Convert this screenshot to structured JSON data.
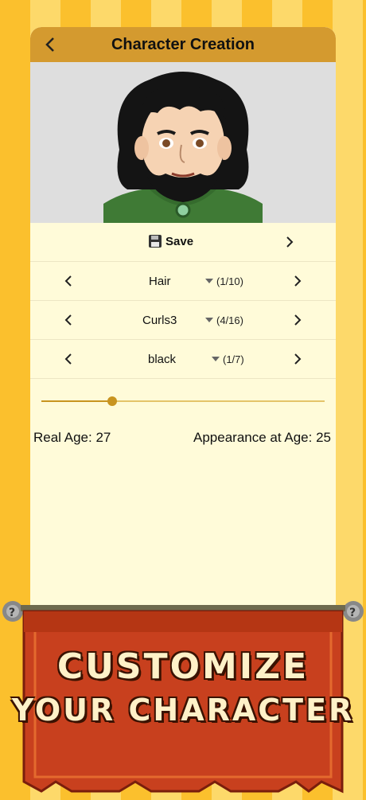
{
  "header": {
    "title": "Character Creation"
  },
  "icons": {
    "back": "chevron-left-icon",
    "save": "floppy-disk-icon",
    "prev": "chevron-left-icon",
    "next": "chevron-right-icon",
    "dropdown": "caret-down-icon"
  },
  "save_row": {
    "label": "Save"
  },
  "selectors": [
    {
      "label": "Hair",
      "count": "(1/10)"
    },
    {
      "label": "Curls3",
      "count": "(4/16)"
    },
    {
      "label": "black",
      "count": "(1/7)"
    }
  ],
  "age_slider": {
    "fraction": 0.25
  },
  "ages": {
    "real": "Real Age: 27",
    "appearance": "Appearance at Age: 25"
  },
  "banner": {
    "line1": "CUSTOMIZE",
    "line2": "YOUR CHARACTER"
  },
  "colors": {
    "header": "#d49a2f",
    "panel": "#fffbd9",
    "banner": "#c8401e",
    "accent": "#c89420"
  }
}
